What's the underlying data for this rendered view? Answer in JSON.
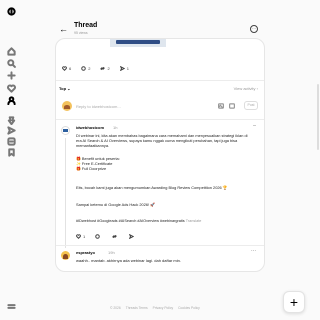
{
  "rail": {
    "icons": [
      "threads-logo-icon",
      "home-icon",
      "search-icon",
      "create-icon",
      "heart-icon",
      "profile-icon",
      "pin-icon",
      "send-icon",
      "likes-icon",
      "bookmark-icon",
      "menu-icon"
    ]
  },
  "header": {
    "back_glyph": "←",
    "title": "Thread",
    "subtitle": "95 views",
    "more_glyph": "···"
  },
  "post": {
    "image_caption": "",
    "likes": "6",
    "comments": "2",
    "reposts": "2",
    "shares": "1"
  },
  "sort": {
    "label": "Top ⌄",
    "view_activity": "View activity ›"
  },
  "reply": {
    "placeholder": "Reply to idwebhostcom...",
    "post_label": "Post"
  },
  "comment": {
    "user": "idwebhostcom",
    "time": "1h",
    "more_glyph": "···",
    "p1": "Di webinar ini, kita akan membahas bagaimana cara memahami dan menyesuaikan strategi iklan di era AI Search & AI Overviews, supaya kamu nggak cuma mengikuti perubahan, tapi juga bisa memanfaatkannya.",
    "p2_title": "🎁 Benefit untuk peserta:",
    "p2_lines": [
      "✨ Free E-Certificate",
      "🎁 Full Doorprize"
    ],
    "p3": "Eits, bocah kami juga akan mengumumkan Awarding Blog Review Competition 2026 🏆",
    "p4": "Sampai ketemu di Google Ads Hack 2026! 🚀",
    "tags": "#IDwebhost #Googleads #AISearch #AIOverview #webinargratis",
    "translate": "Translate",
    "likes": "1",
    "comments": "",
    "reposts": "",
    "shares": ""
  },
  "reply_comment": {
    "user": "esprastyo",
    "time": "19h",
    "more_glyph": "···",
    "text": "waahh.. mantab. akhirnya ada webinar lagi. dah daftar min."
  },
  "footer": [
    "© 2026",
    "Threads Terms",
    "Privacy Policy",
    "Cookies Policy"
  ],
  "fab": {
    "label": "+"
  }
}
